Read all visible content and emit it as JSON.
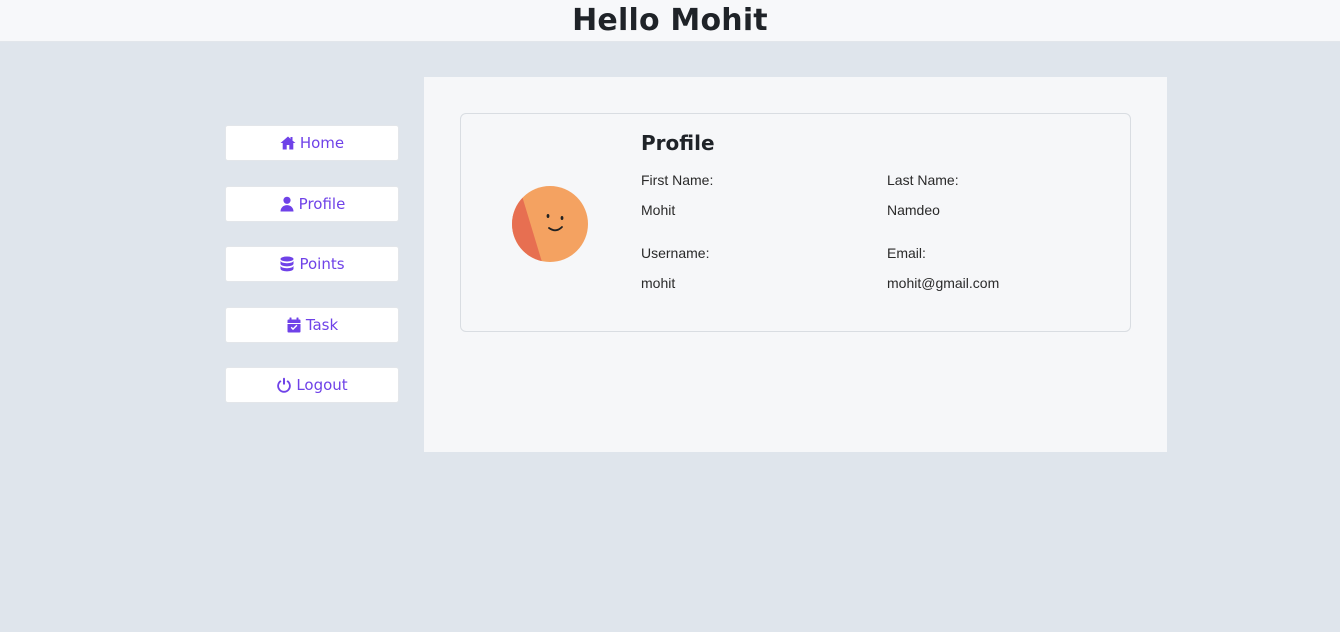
{
  "header": {
    "title": "Hello Mohit"
  },
  "sidebar": {
    "items": [
      {
        "label": "Home",
        "icon": "home-icon"
      },
      {
        "label": "Profile",
        "icon": "user-icon"
      },
      {
        "label": "Points",
        "icon": "database-icon"
      },
      {
        "label": "Task",
        "icon": "calendar-check-icon"
      },
      {
        "label": "Logout",
        "icon": "power-icon"
      }
    ]
  },
  "profile": {
    "title": "Profile",
    "first_name_label": "First Name:",
    "first_name": "Mohit",
    "last_name_label": "Last Name:",
    "last_name": "Namdeo",
    "username_label": "Username:",
    "username": "mohit",
    "email_label": "Email:",
    "email": "mohit@gmail.com"
  },
  "colors": {
    "accent": "#6f42e8",
    "page_bg": "#dfe5ec",
    "avatar_orange": "#f4a261",
    "avatar_red": "#e76f51"
  }
}
